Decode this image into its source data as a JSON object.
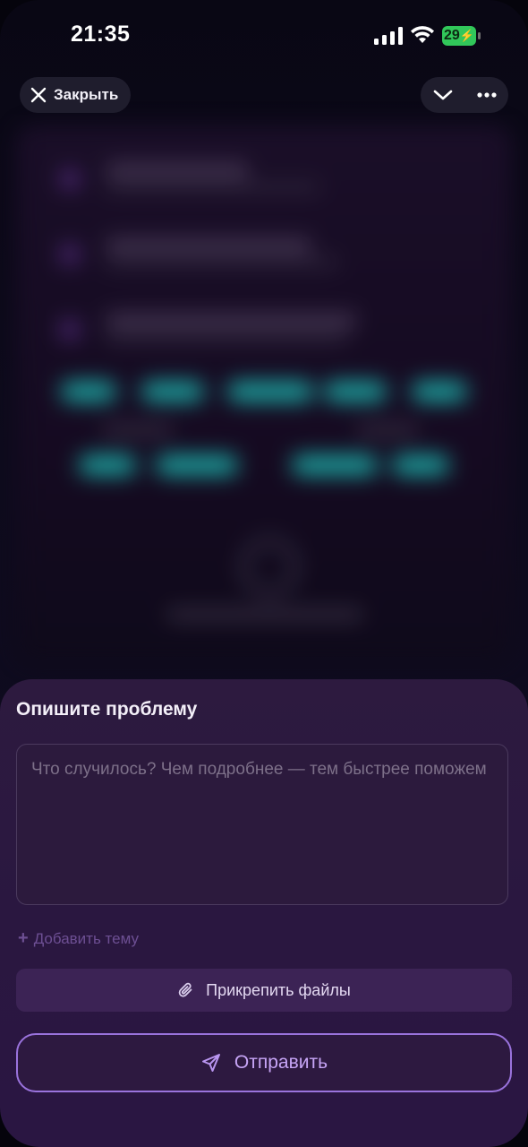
{
  "status_bar": {
    "time": "21:35",
    "battery_level": "29",
    "icons": [
      "signal-icon",
      "wifi-icon",
      "battery-charging-icon"
    ]
  },
  "top_bar": {
    "close_label": "Закрыть",
    "icons": [
      "close-icon",
      "chevron-down-icon",
      "more-icon"
    ]
  },
  "sheet": {
    "title": "Опишите проблему",
    "description_placeholder": "Что случилось? Чем подробнее — тем быстрее поможем",
    "add_topic_label": "Добавить тему",
    "attach_label": "Прикрепить файлы",
    "send_label": "Отправить",
    "icons": [
      "plus-icon",
      "paperclip-icon",
      "send-icon"
    ]
  },
  "colors": {
    "background": "#0d0a1c",
    "sheet": "#2a1740",
    "accent": "#9a73dd",
    "battery": "#31c75a",
    "blurred_teal": "#1fb6b0"
  }
}
